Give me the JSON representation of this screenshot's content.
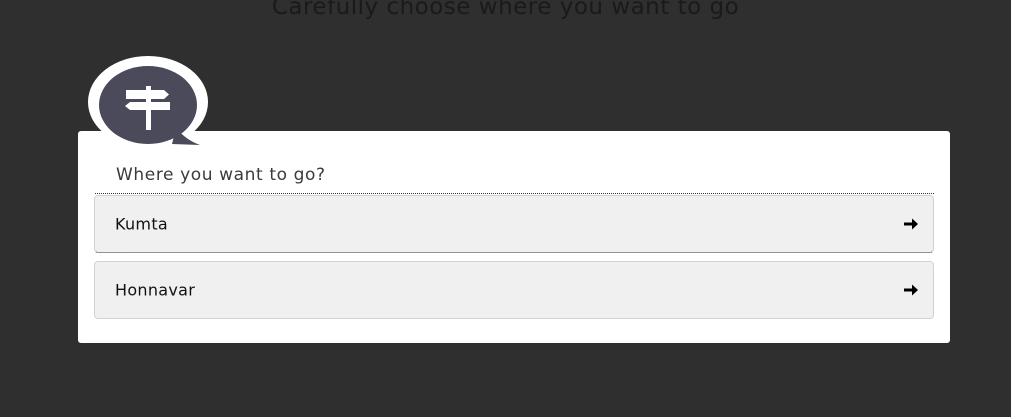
{
  "page": {
    "heading": "Carefully choose where you want to go"
  },
  "card": {
    "icon": "signpost-chat-bubble-icon",
    "question": "Where you want to go?",
    "options": [
      {
        "label": "Kumta",
        "icon": "arrow-right-icon"
      },
      {
        "label": "Honnavar",
        "icon": "arrow-right-icon"
      }
    ]
  },
  "colors": {
    "background": "#2f2f2f",
    "card": "#ffffff",
    "bubble": "#4a4a5a",
    "option_background": "#f0f0f0"
  }
}
